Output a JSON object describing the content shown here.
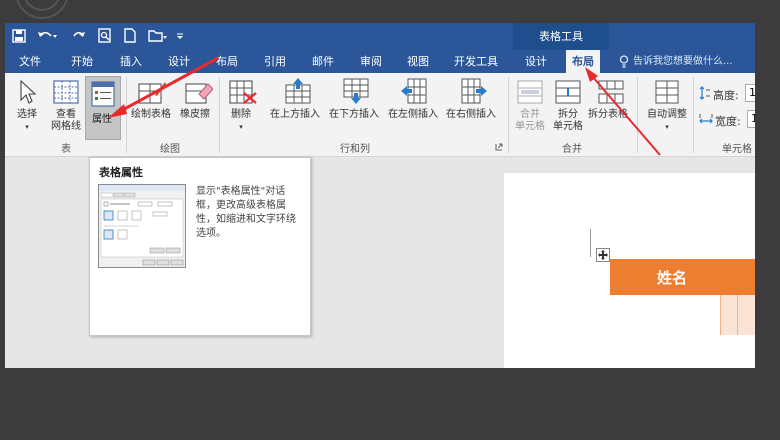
{
  "context_tab_group": "表格工具",
  "tabs": [
    "文件",
    "开始",
    "插入",
    "设计",
    "布局",
    "引用",
    "邮件",
    "审阅",
    "视图",
    "开发工具",
    "设计",
    "布局"
  ],
  "tell_me": "告诉我您想要做什么...",
  "ribbon": {
    "select": "选择",
    "view_gridlines": [
      "查看",
      "网格线"
    ],
    "properties": "属性",
    "draw_table": "绘制表格",
    "eraser": "橡皮擦",
    "delete": "删除",
    "insert_above": "在上方插入",
    "insert_below": "在下方插入",
    "insert_left": "在左侧插入",
    "insert_right": "在右侧插入",
    "merge_cells": [
      "合并",
      "单元格"
    ],
    "split_cells": [
      "拆分",
      "单元格"
    ],
    "split_table": "拆分表格",
    "autofit": "自动调整",
    "height_label": "高度:",
    "width_label": "宽度:",
    "height_value": "1",
    "width_value": "1",
    "groups": [
      "表",
      "绘图",
      "行和列",
      "合并",
      "单元格"
    ]
  },
  "tooltip": {
    "title": "表格属性",
    "body": [
      "显示\"表格属性\"对话",
      "框，更改高级表格属",
      "性，如缩进和文字环绕",
      "选项。"
    ]
  },
  "document": {
    "table_header": "姓名"
  },
  "colors": {
    "brand_blue": "#2b579a",
    "table_header_orange": "#ed7d31",
    "table_cell_peach": "#fbe4d5",
    "annotation_red": "#e8292e"
  }
}
